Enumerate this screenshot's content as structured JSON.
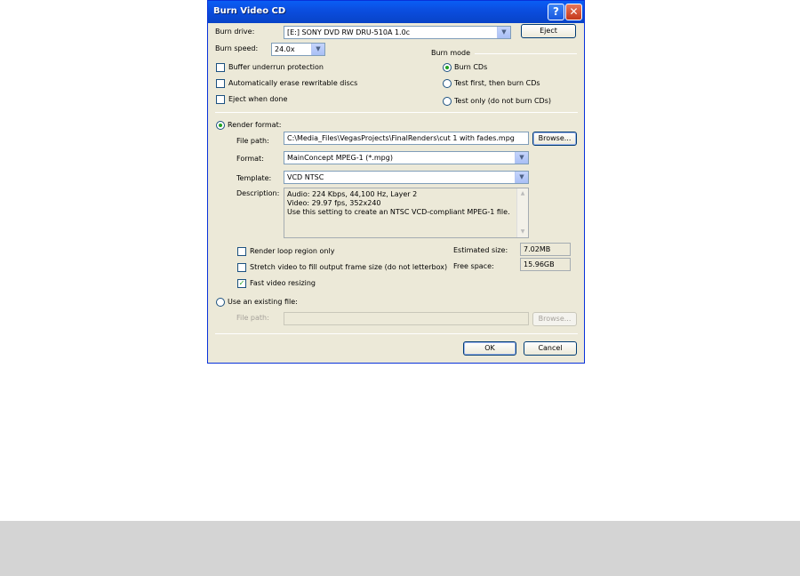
{
  "window": {
    "title": "Burn Video CD"
  },
  "burn_drive": {
    "label": "Burn drive:",
    "value": "[E:] SONY DVD RW DRU-510A 1.0c",
    "eject_label": "Eject"
  },
  "burn_speed": {
    "label": "Burn speed:",
    "value": "24.0x"
  },
  "options": {
    "buffer_underrun": "Buffer underrun protection",
    "auto_erase": "Automatically erase rewritable discs",
    "eject_when_done": "Eject when done"
  },
  "burn_mode": {
    "label": "Burn mode",
    "burn_cds": "Burn CDs",
    "test_first": "Test first, then burn CDs",
    "test_only": "Test only (do not burn CDs)"
  },
  "render_format": {
    "label": "Render format:",
    "file_path_label": "File path:",
    "file_path_value": "C:\\Media_Files\\VegasProjects\\FinalRenders\\cut 1 with fades.mpg",
    "browse_label": "Browse...",
    "format_label": "Format:",
    "format_value": "MainConcept MPEG-1 (*.mpg)",
    "template_label": "Template:",
    "template_value": "VCD NTSC",
    "description_label": "Description:",
    "description_lines": [
      "Audio: 224 Kbps, 44,100 Hz, Layer 2",
      "Video: 29.97 fps, 352x240",
      "Use this setting to create an NTSC VCD-compliant MPEG-1 file."
    ],
    "render_loop": "Render loop region only",
    "stretch_video": "Stretch video to fill output frame size (do not letterbox)",
    "fast_resizing": "Fast video resizing",
    "estimated_size_label": "Estimated size:",
    "estimated_size_value": "7.02MB",
    "free_space_label": "Free space:",
    "free_space_value": "15.96GB"
  },
  "existing_file": {
    "label": "Use an existing file:",
    "file_path_label": "File path:",
    "browse_label": "Browse..."
  },
  "buttons": {
    "ok": "OK",
    "cancel": "Cancel"
  }
}
